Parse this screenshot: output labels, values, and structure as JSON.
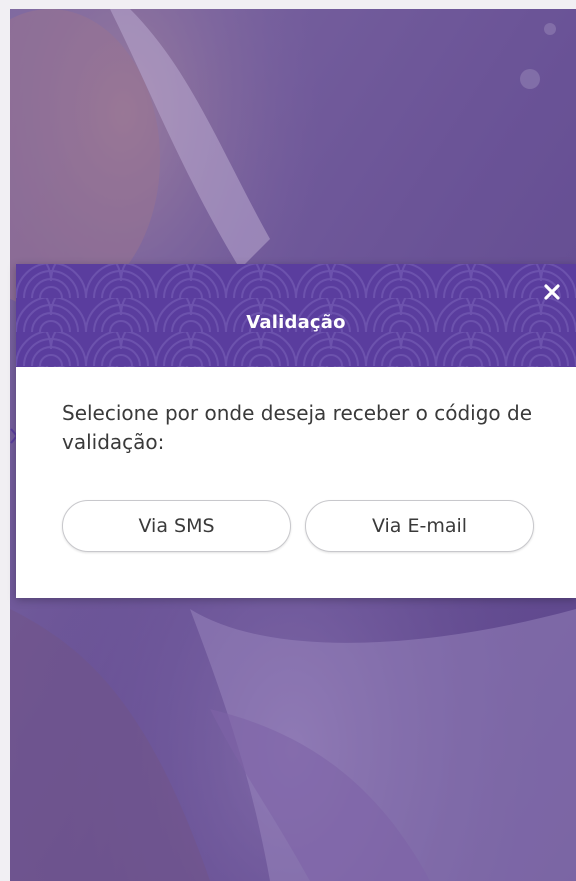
{
  "colors": {
    "header_bg": "#5a3d9e",
    "overlay": "#6b5a8e",
    "button_border": "#c8c8cc",
    "text": "#3a3a3a"
  },
  "background": {
    "image_icon": "people-photo-icon"
  },
  "modal": {
    "title": "Validação",
    "close_icon": "close-icon",
    "message": "Selecione por onde deseja receber o código de validação:",
    "options": [
      {
        "label": "Via SMS"
      },
      {
        "label": "Via E-mail"
      }
    ]
  }
}
